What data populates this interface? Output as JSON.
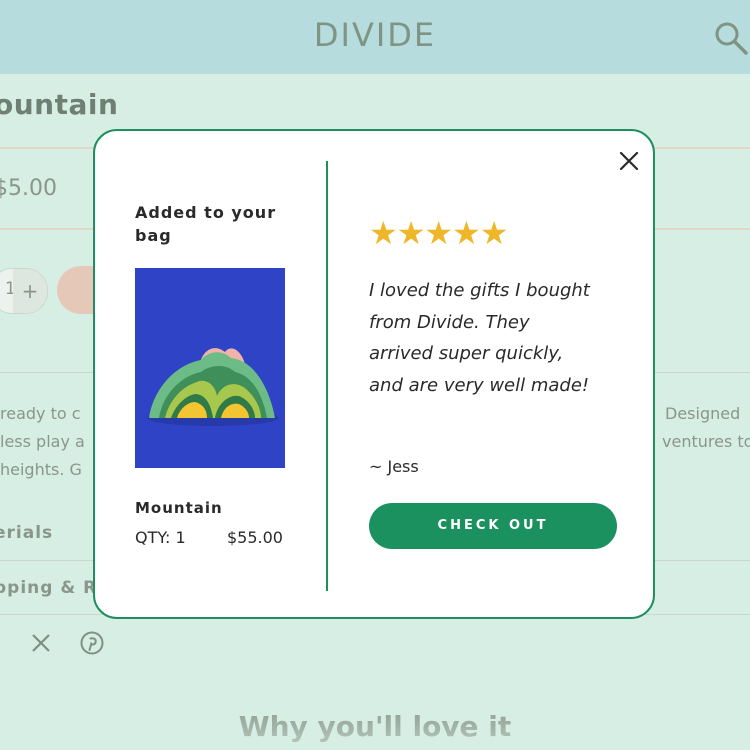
{
  "header": {
    "brand": "DIVIDE",
    "search_icon": "search-icon"
  },
  "background_page": {
    "product_title": "ountain",
    "price": "5.00",
    "quantity": "1",
    "quantity_plus": "+",
    "description_lines": [
      {
        "left": "ready to c",
        "right": "Designed"
      },
      {
        "left": "less play a",
        "right": "ventures to"
      },
      {
        "left": " heights. G",
        "right": ""
      }
    ],
    "accordions": [
      "erials",
      "pping & R"
    ],
    "social_icons": [
      "x-icon",
      "pinterest-icon"
    ],
    "why_heading": "Why you'll love it"
  },
  "modal": {
    "close_icon": "close-icon",
    "added_title": "Added to your bag",
    "product": {
      "name": "Mountain",
      "qty_text": "QTY: 1",
      "price": "$55.00",
      "image": "mountain-toy-image"
    },
    "review": {
      "stars": "★★★★★",
      "rating": 5,
      "quote": "I loved the gifts I bought from Divide. They arrived super quickly, and are very well made!",
      "author": "~ Jess"
    },
    "checkout_label": "CHECK OUT"
  },
  "colors": {
    "page_bg": "#d7eee5",
    "header_bg": "#b7dcde",
    "accent_green": "#1c9160",
    "star": "#f0b62a",
    "image_bg": "#2f43c6"
  }
}
